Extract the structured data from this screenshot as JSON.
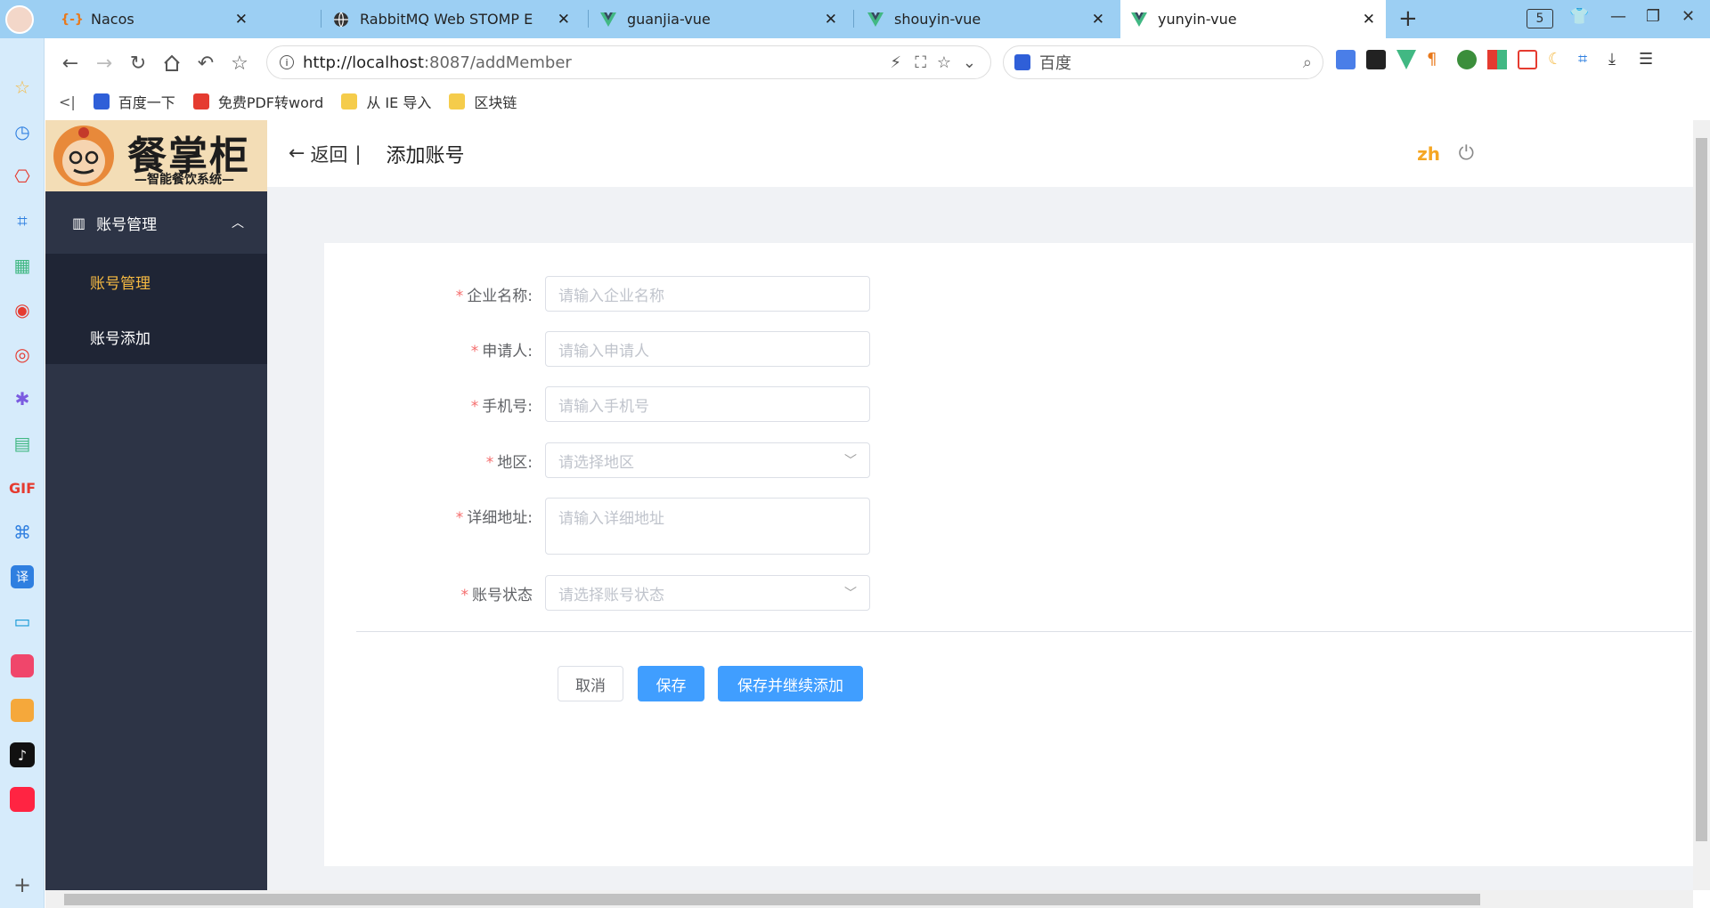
{
  "browser": {
    "tabs": [
      {
        "title": "Nacos",
        "icon": "nacos-icon",
        "color": "#e8791c"
      },
      {
        "title": "RabbitMQ Web STOMP Examp",
        "icon": "globe-icon",
        "color": "#333333"
      },
      {
        "title": "guanjia-vue",
        "icon": "vue-icon",
        "color": "#41b883"
      },
      {
        "title": "shouyin-vue",
        "icon": "vue-icon",
        "color": "#41b883"
      },
      {
        "title": "yunyin-vue",
        "icon": "vue-icon",
        "color": "#41b883"
      }
    ],
    "active_tab": 4,
    "tab_count": "5",
    "url_host": "http://localhost",
    "url_rest": ":8087/addMember",
    "search_engine": "百度",
    "bookmarks": [
      {
        "label": "百度一下",
        "icon": "baidu-icon",
        "color": "#2f5fd8"
      },
      {
        "label": "免费PDF转word",
        "icon": "pdf-icon",
        "color": "#e53b30"
      },
      {
        "label": "从 IE 导入",
        "icon": "folder-icon",
        "color": "#f5cc4b"
      },
      {
        "label": "区块链",
        "icon": "folder-icon",
        "color": "#f5cc4b"
      }
    ]
  },
  "app": {
    "logo_text": "餐掌柜",
    "logo_subtitle": "—智能餐饮系统—",
    "menu": {
      "group_label": "账号管理",
      "items": [
        {
          "label": "账号管理",
          "active": true
        },
        {
          "label": "账号添加",
          "active": false
        }
      ]
    },
    "header": {
      "back_label": "返回",
      "divider": "|",
      "page_title": "添加账号",
      "lang": "zh"
    },
    "form": {
      "fields": [
        {
          "label": "企业名称:",
          "placeholder": "请输入企业名称",
          "type": "input"
        },
        {
          "label": "申请人:",
          "placeholder": "请输入申请人",
          "type": "input"
        },
        {
          "label": "手机号:",
          "placeholder": "请输入手机号",
          "type": "input"
        },
        {
          "label": "地区:",
          "placeholder": "请选择地区",
          "type": "select"
        },
        {
          "label": "详细地址:",
          "placeholder": "请输入详细地址",
          "type": "textarea"
        },
        {
          "label": "账号状态",
          "placeholder": "请选择账号状态",
          "type": "select"
        }
      ],
      "required_mark": "*",
      "buttons": {
        "cancel": "取消",
        "save": "保存",
        "save_continue": "保存并继续添加"
      }
    }
  },
  "colors": {
    "accent": "#409eff",
    "sidebar": "#2d3446",
    "menu_active": "#f5b942",
    "required": "#f56c6c"
  }
}
